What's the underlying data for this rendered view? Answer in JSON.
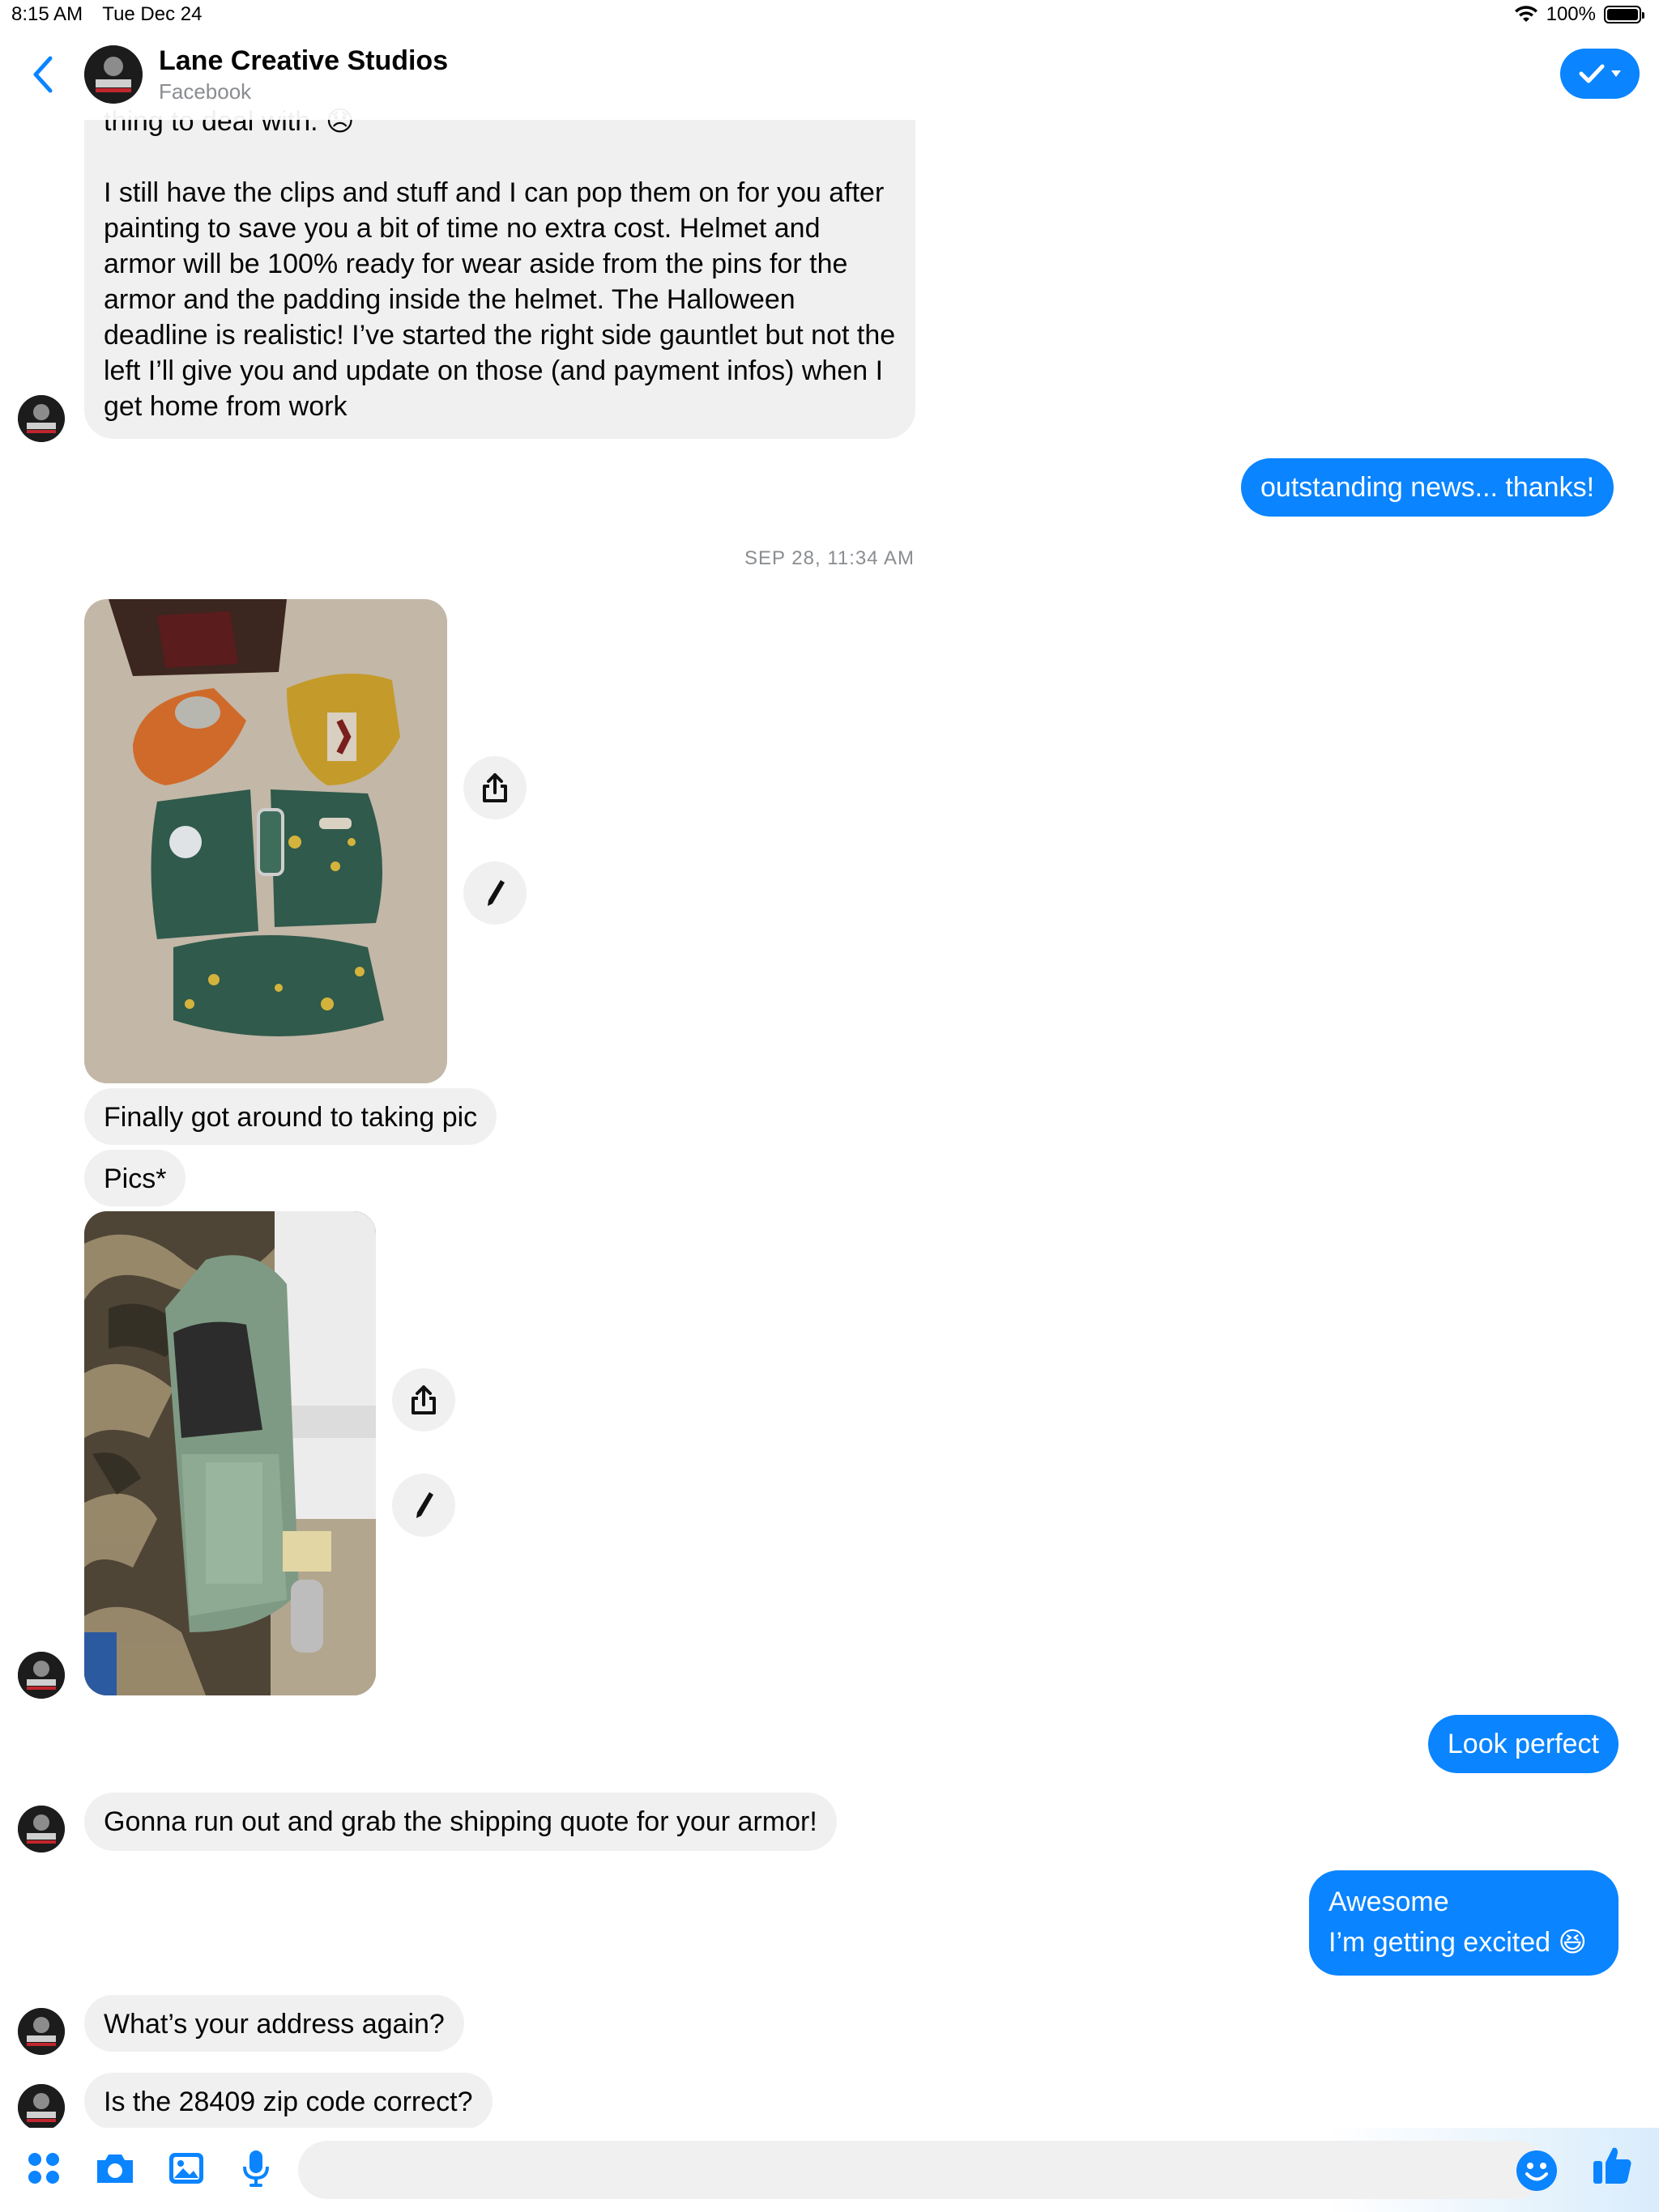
{
  "status_bar": {
    "time": "8:15 AM",
    "date": "Tue Dec 24",
    "battery": "100%",
    "battery_level": 1.0
  },
  "header": {
    "title": "Lane Creative Studios",
    "subtitle": "Facebook",
    "icons": {
      "back": "chevron-left-icon",
      "status": "check-icon",
      "dropdown": "caret-down-icon"
    }
  },
  "messages": {
    "m1_line0": "thing to deal with. 😞",
    "m1_para2": "I still have the clips and stuff and I can pop them on for you after painting to save you a bit of time no extra cost. Helmet and armor will be 100% ready for wear aside from the pins for the armor and the padding inside the helmet. The Halloween deadline is realistic! I’ve started the right side gauntlet but not the left I’ll give you and update on those (and payment infos) when I get home from work",
    "m2": "outstanding news... thanks!",
    "timestamp": "SEP 28, 11:34 AM",
    "m3": "Finally got around to taking pic",
    "m4": "Pics*",
    "m5": "Look perfect",
    "m6": "Gonna run out and grab the shipping quote for your armor!",
    "m7_line1": "Awesome",
    "m7_line2": "I’m getting excited 😆",
    "m8": "What’s your address again?",
    "m9": "Is the 28409 zip code correct?"
  },
  "composer": {
    "icons": [
      "apps-icon",
      "camera-icon",
      "photo-icon",
      "microphone-icon",
      "emoji-icon",
      "thumbs-up-icon"
    ]
  },
  "colors": {
    "accent": "#0a84ff",
    "incoming_bubble": "#f0f0f0",
    "meta_text": "#8a8d91"
  }
}
